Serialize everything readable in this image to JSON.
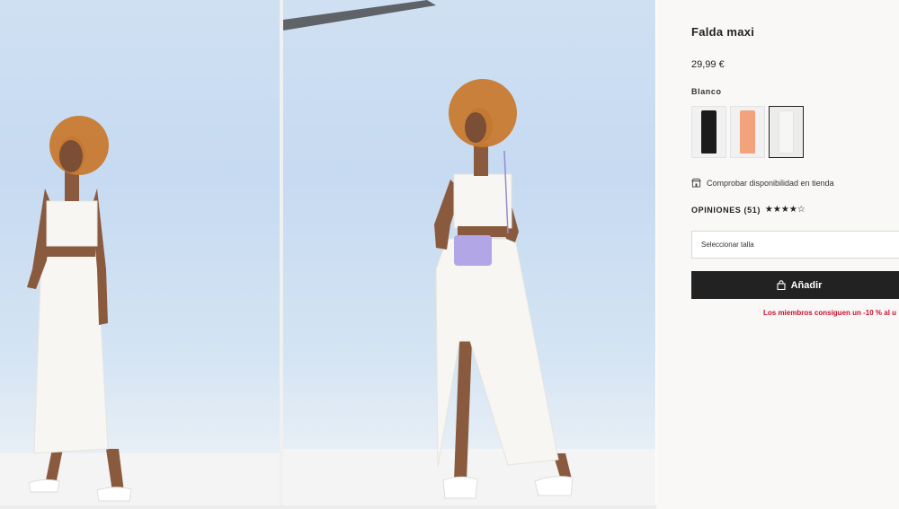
{
  "product": {
    "title": "Falda maxi",
    "price": "29,99 €",
    "selected_color": "Blanco",
    "swatches": [
      {
        "color": "#1b1b1b",
        "name": "black"
      },
      {
        "color": "#f2a37c",
        "name": "peach"
      },
      {
        "color": "#f6f6f4",
        "name": "white",
        "selected": true
      }
    ],
    "availability": "Comprobar disponibilidad en tienda",
    "reviews_label": "OPINIONES (51)",
    "stars": "★★★★☆",
    "rating": 4,
    "size_placeholder": "Seleccionar talla",
    "add_label": "Añadir",
    "promo": "Los miembros consiguen un -10 % al u"
  },
  "colors": {
    "accent_dark": "#222222",
    "promo_red": "#c8102e",
    "panel_bg": "#f9f8f7",
    "backdrop_blue": "#c6daf1"
  }
}
